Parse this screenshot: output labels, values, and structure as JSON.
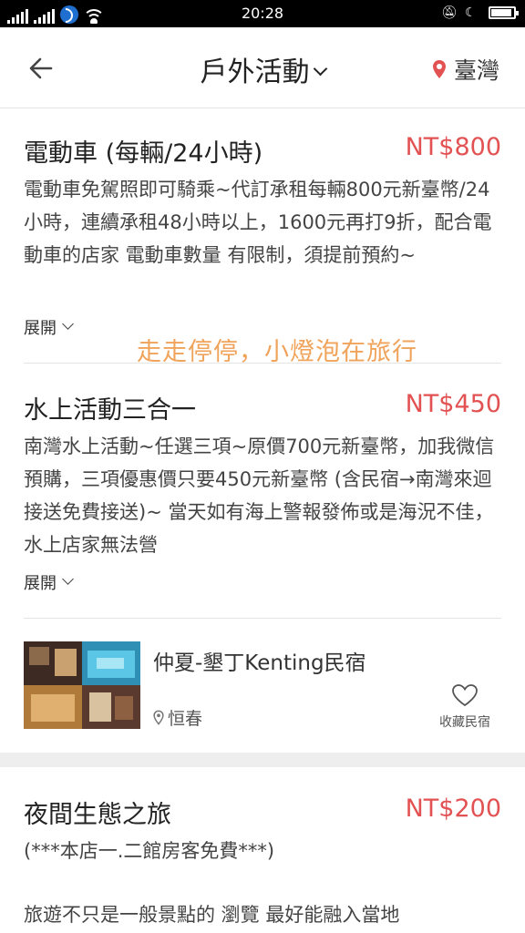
{
  "status_bar": {
    "time": "20:28",
    "battery_level": 0.9
  },
  "header": {
    "back_icon": "arrow-left-icon",
    "title": "戶外活動",
    "location": "臺灣",
    "location_icon": "map-pin-icon",
    "accent_color": "#e35252"
  },
  "activities": [
    {
      "title": "電動車 (每輛/24小時)",
      "price": "NT$800",
      "desc": "電動車免駕照即可騎乘~代訂承租每輛800元新臺幣/24小時，連續承租48小時以上，1600元再打9折，配合電動車的店家 電動車數量 有限制，須提前預約~",
      "expand_label": "展開"
    },
    {
      "title": "水上活動三合一",
      "price": "NT$450",
      "desc": "南灣水上活動~任選三項~原價700元新臺幣，加我微信預購，三項優惠價只要450元新臺幣 (含民宿→南灣來迴接送免費接送)~ 當天如有海上警報發佈或是海況不佳，水上店家無法營",
      "expand_label": "展開"
    },
    {
      "title": "夜間生態之旅",
      "price": "NT$200",
      "desc": "(***本店一.二館房客免費***)",
      "desc2": "旅遊不只是一般景點的 瀏覽   最好能融入當地"
    }
  ],
  "watermark": "走走停停，小燈泡在旅行",
  "lodging": {
    "name": "仲夏-墾丁Kenting民宿",
    "location": "恒春",
    "favorite_label": "收藏民宿",
    "favorite_icon": "heart-icon"
  }
}
